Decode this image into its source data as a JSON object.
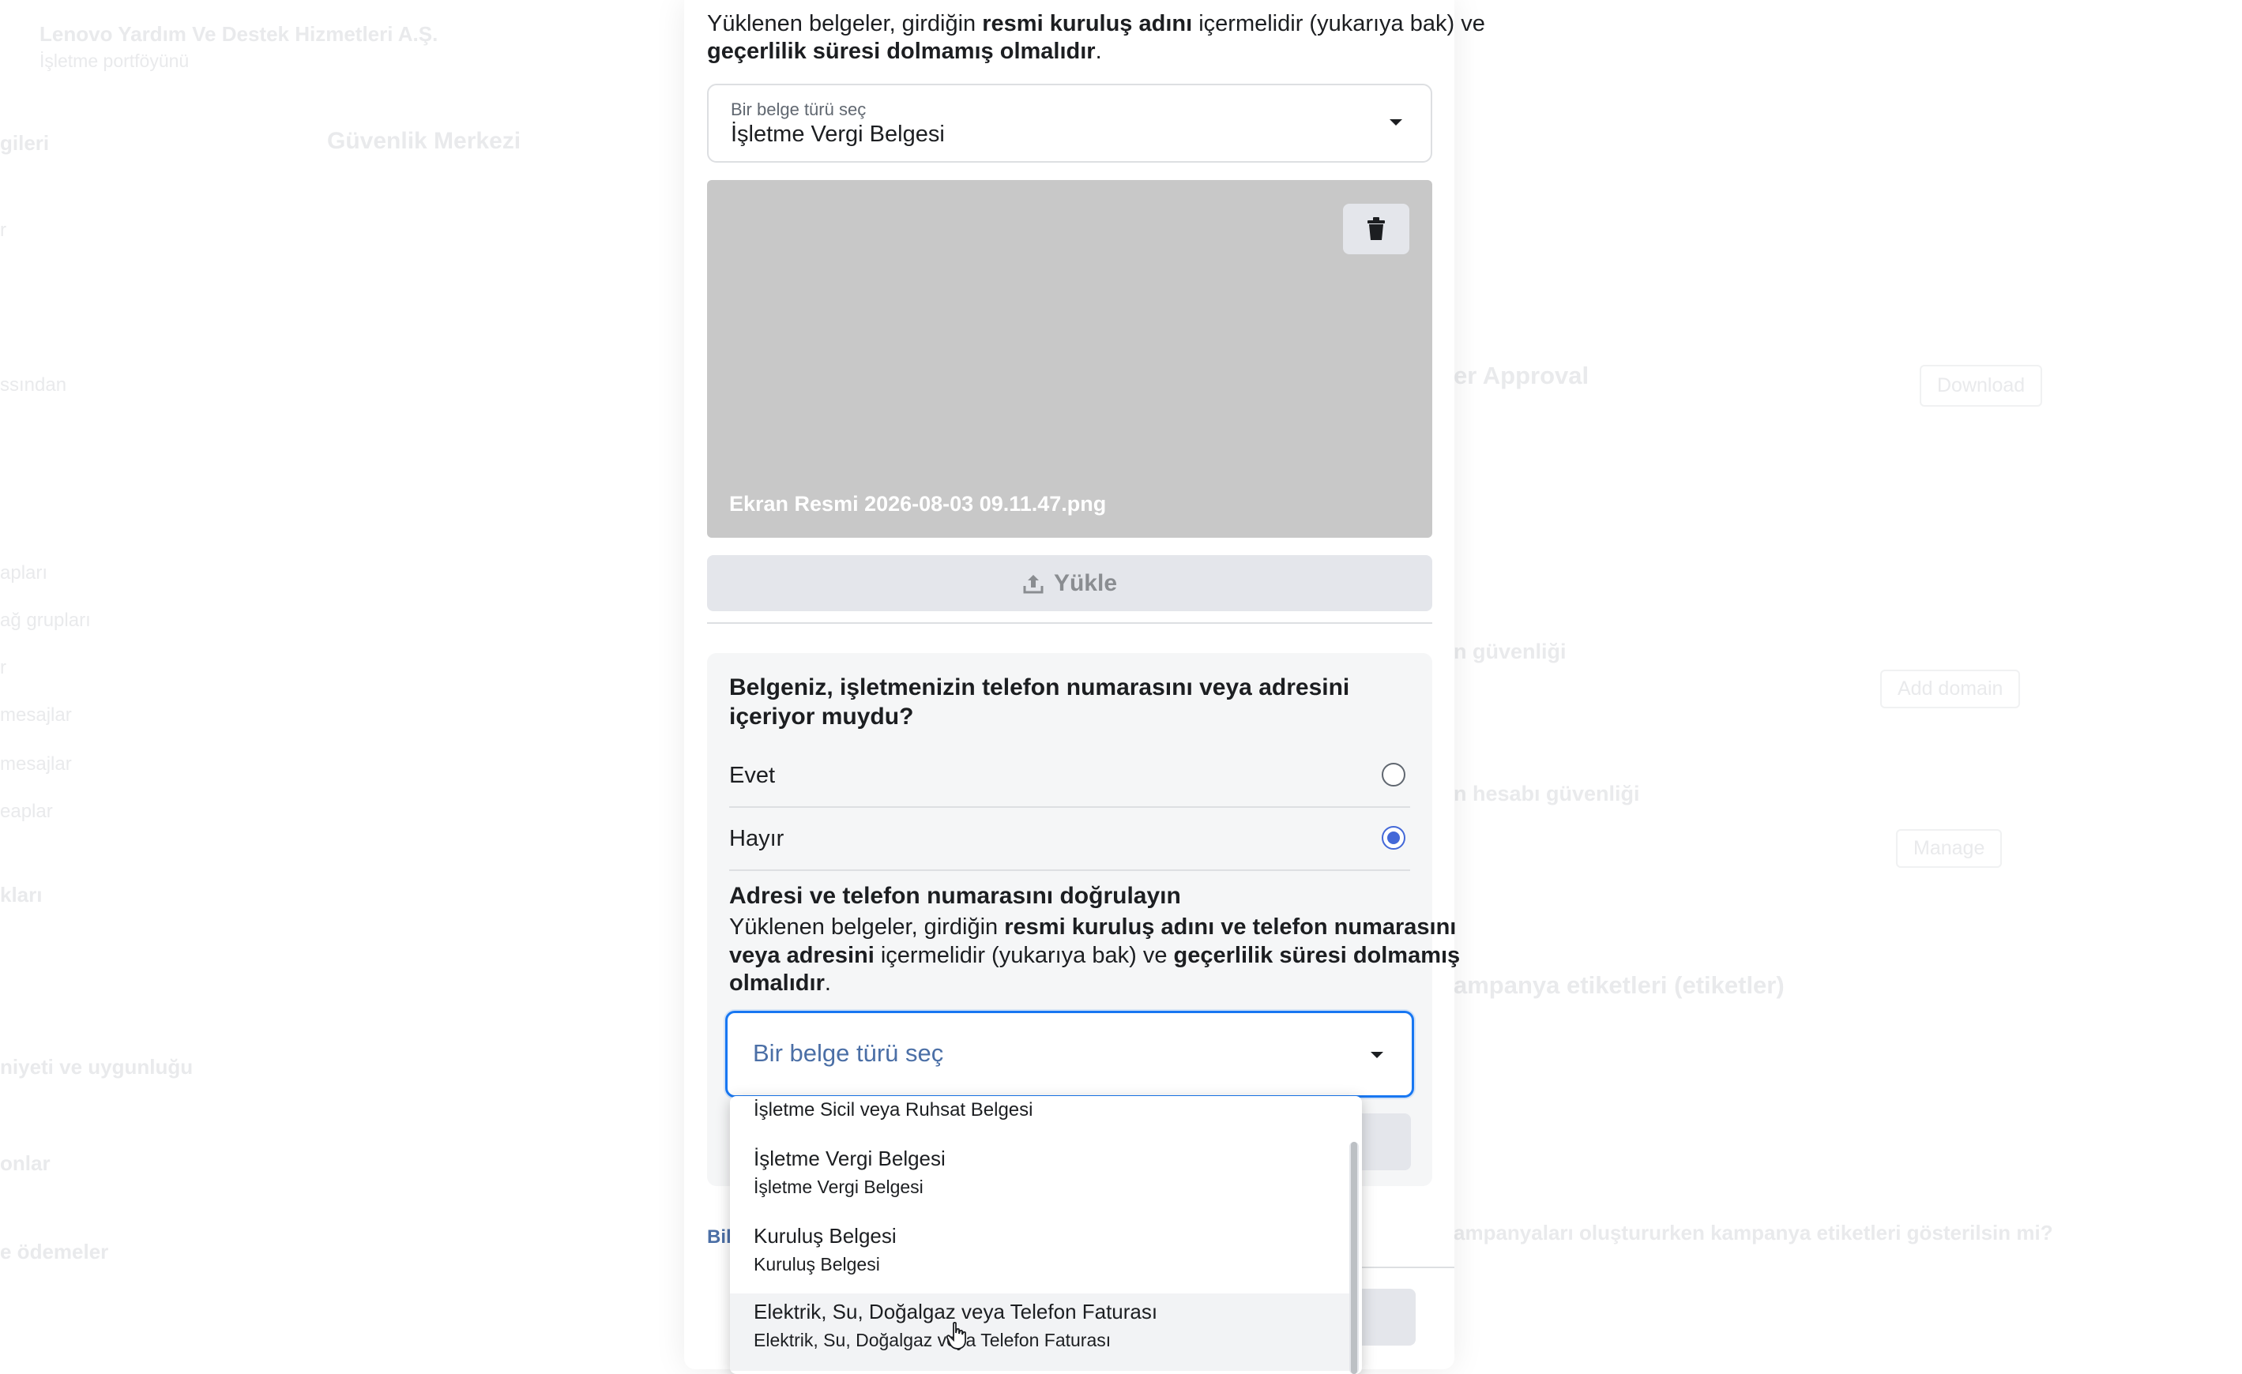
{
  "background": {
    "business_name": "Lenovo Yardım Ve Destek Hizmetleri A.Ş.",
    "portfolio_label": "İşletme portföyünü",
    "page_title": "Güvenlik Merkezi",
    "section_approval": "er Approval",
    "download_label": "Download",
    "section_domain": "n güvenliği",
    "add_domain_label": "Add domain",
    "section_account": "n hesabı güvenliği",
    "manage_label": "Manage",
    "section_tags": "ampanya etiketleri (etiketler)",
    "tags_question": "ampanyaları oluştururken kampanya etiketleri gösterilsin mi?",
    "sidebar_items": [
      "gileri",
      "r",
      "ssından",
      "apları",
      "ağ grupları",
      "r",
      "mesajlar",
      "mesajlar",
      "eaplar",
      "kları",
      "niyeti ve uygunluğu",
      "onlar",
      "e ödemeler"
    ]
  },
  "modal": {
    "intro_line1_a": "Yüklenen belgeler, girdiğin ",
    "intro_line1_b": "resmi kuruluş adını",
    "intro_line1_c": " içermelidir (yukarıya bak) ve",
    "intro_line2_a": "geçerlilik süresi dolmamış olmalıdır",
    "intro_line2_b": ".",
    "doc_type_label": "Bir belge türü seç",
    "doc_type_value": "İşletme Vergi Belgesi",
    "file_name": "Ekran Resmi 2026-08-03 09.11.47.png",
    "upload_label": "Yükle",
    "question": "Belgeniz, işletmenizin telefon numarasını veya adresini içeriyor muydu?",
    "option_yes": "Evet",
    "option_no": "Hayır",
    "selected_option": "Hayır",
    "verify_title": "Adresi ve telefon numarasını doğrulayın",
    "verify_1a": "Yüklenen belgeler, girdiğin ",
    "verify_1b": "resmi kuruluş adını ve telefon numarasını",
    "verify_2a": "veya adresini",
    "verify_2b": " içermelidir (yukarıya bak) ve ",
    "verify_2c": "geçerlilik süresi dolmamış",
    "verify_3a": "olmalıdır",
    "verify_3b": ".",
    "second_select_placeholder": "Bir belge türü seç",
    "footer_link_partial": "Bil"
  },
  "dropdown": {
    "items": [
      {
        "title": "İşletme Sicil veya Ruhsat Belgesi",
        "subtitle": ""
      },
      {
        "title": "İşletme Vergi Belgesi",
        "subtitle": "İşletme Vergi Belgesi"
      },
      {
        "title": "Kuruluş Belgesi",
        "subtitle": "Kuruluş Belgesi"
      },
      {
        "title": "Elektrik, Su, Doğalgaz veya Telefon Faturası",
        "subtitle": "Elektrik, Su, Doğalgaz veya Telefon Faturası"
      }
    ],
    "hovered_index": 3
  },
  "colors": {
    "accent": "#1877f2",
    "placeholder_blue": "#4b6fa6",
    "radio_selected": "#4368d8"
  }
}
